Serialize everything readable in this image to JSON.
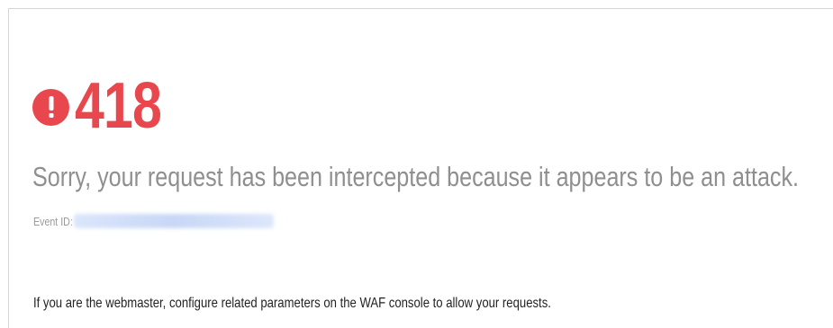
{
  "error": {
    "code": "418",
    "icon": "exclamation-circle-icon",
    "accent_color": "#e8474d"
  },
  "message": {
    "headline": "Sorry, your request has been intercepted because it appears to be an attack."
  },
  "event": {
    "label": "Event ID:",
    "value": "",
    "value_redacted": true
  },
  "note": {
    "text": "If you are the webmaster, configure related parameters on the WAF console to allow your requests."
  }
}
